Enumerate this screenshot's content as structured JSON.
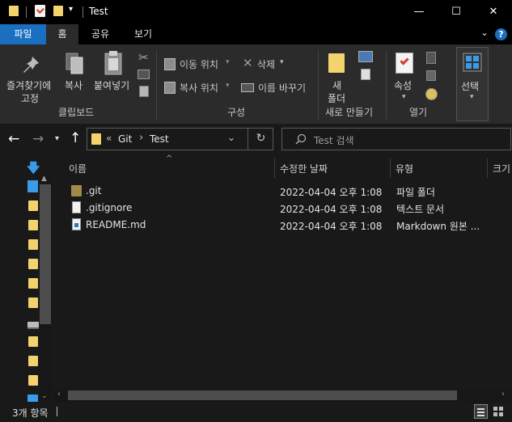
{
  "window": {
    "title": "Test",
    "minimize": "—",
    "maximize": "☐",
    "close": "✕"
  },
  "tabs": [
    "파일",
    "홈",
    "공유",
    "보기"
  ],
  "ribbon": {
    "pin": "즐겨찾기에\n고정",
    "pin_l1": "즐겨찾기에",
    "pin_l2": "고정",
    "copy": "복사",
    "paste": "붙여넣기",
    "move_to": "이동 위치",
    "copy_to": "복사 위치",
    "delete": "삭제",
    "rename": "이름 바꾸기",
    "new_folder_l1": "새",
    "new_folder_l2": "폴더",
    "properties": "속성",
    "select": "선택",
    "groups": {
      "clipboard": "클립보드",
      "organize": "구성",
      "new": "새로 만들기",
      "open": "열기"
    }
  },
  "address": {
    "overflow": "«",
    "crumbs": [
      "Git",
      "Test"
    ],
    "search_placeholder": "Test 검색"
  },
  "columns": {
    "name": "이름",
    "modified": "수정한 날짜",
    "type": "유형",
    "size": "크기"
  },
  "files": [
    {
      "name": ".git",
      "modified": "2022-04-04 오후 1:08",
      "type": "파일 폴더",
      "icon": "folder-icon"
    },
    {
      "name": ".gitignore",
      "modified": "2022-04-04 오후 1:08",
      "type": "텍스트 문서",
      "icon": "text-file-icon"
    },
    {
      "name": "README.md",
      "modified": "2022-04-04 오후 1:08",
      "type": "Markdown 원본 ...",
      "icon": "markdown-file-icon"
    }
  ],
  "status": {
    "count": "3개 항목"
  },
  "colors": {
    "accent": "#1a6fc0",
    "folder": "#f3d36e",
    "titlebar": "#000000",
    "ribbon": "#2b2b2b",
    "pane": "#191919"
  }
}
